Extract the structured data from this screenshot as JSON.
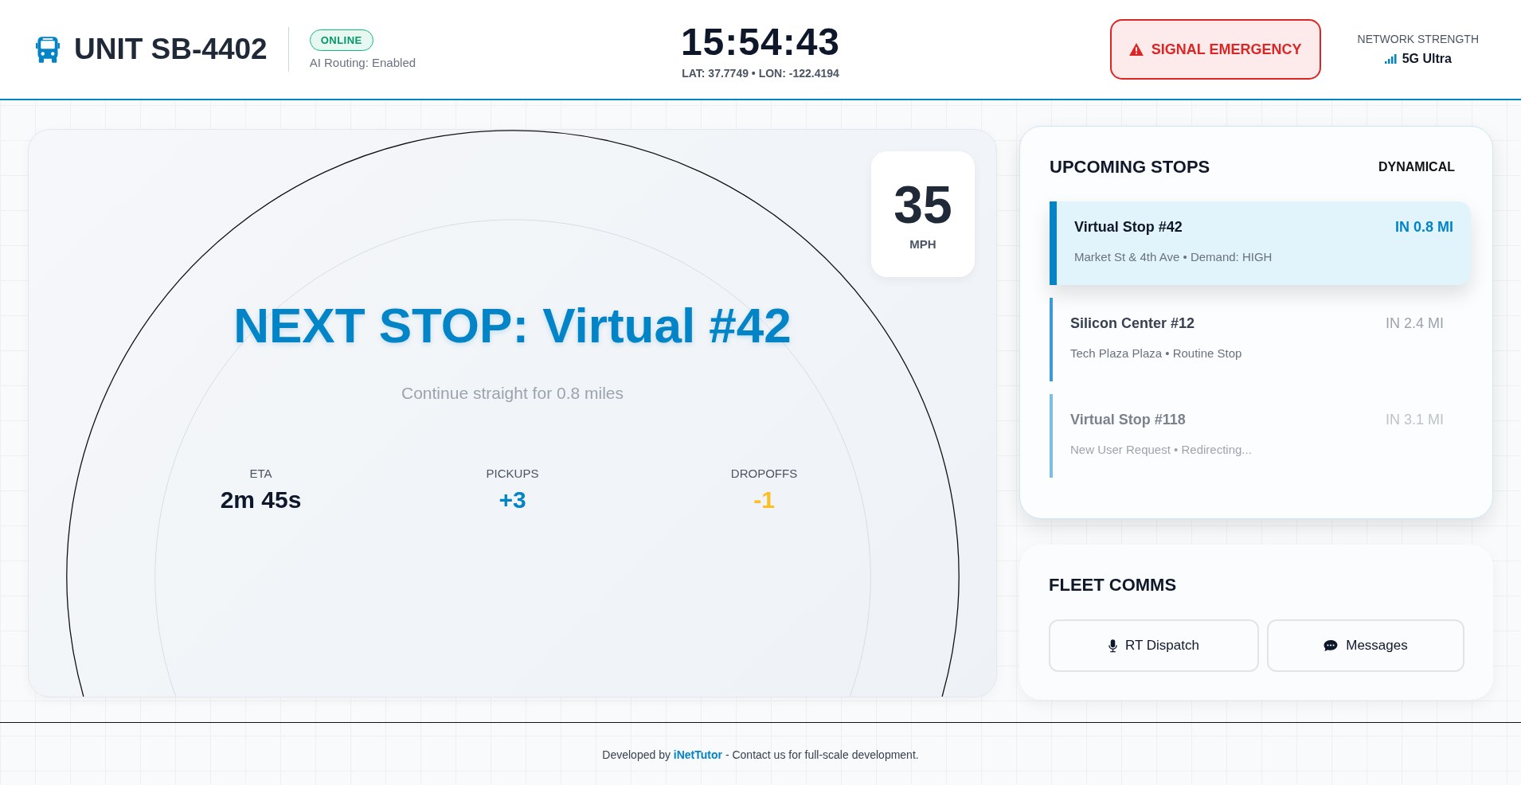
{
  "header": {
    "unit": "UNIT SB-4402",
    "status_badge": "ONLINE",
    "routing": "AI Routing: Enabled",
    "clock": "15:54:43",
    "coords": "LAT: 37.7749 • LON: -122.4194",
    "emergency_button": "SIGNAL EMERGENCY",
    "network": {
      "label": "NETWORK STRENGTH",
      "value": "5G Ultra"
    }
  },
  "navigation": {
    "speed": "35",
    "speed_unit": "MPH",
    "next_stop": "NEXT STOP: Virtual #42",
    "instruction": "Continue straight for 0.8 miles",
    "stats": [
      {
        "label": "ETA",
        "value": "2m 45s",
        "color": "#0f172a"
      },
      {
        "label": "PICKUPS",
        "value": "+3",
        "color": "#0284c7"
      },
      {
        "label": "DROPOFFS",
        "value": "-1",
        "color": "#fbbf24"
      }
    ]
  },
  "upcoming_stops": {
    "title": "UPCOMING STOPS",
    "mode": "DYNAMICAL",
    "stops": [
      {
        "name": "Virtual Stop #42",
        "detail": "Market St & 4th Ave • Demand: HIGH",
        "distance": "IN 0.8 MI",
        "selected": true,
        "dimmed": false
      },
      {
        "name": "Silicon Center #12",
        "detail": "Tech Plaza Plaza • Routine Stop",
        "distance": "IN 2.4 MI",
        "selected": false,
        "dimmed": false
      },
      {
        "name": "Virtual Stop #118",
        "detail": "New User Request • Redirecting...",
        "distance": "IN 3.1 MI",
        "selected": false,
        "dimmed": true
      }
    ]
  },
  "fleet_comms": {
    "title": "FLEET COMMS",
    "buttons": [
      {
        "label": "RT Dispatch",
        "kind": "voice"
      },
      {
        "label": "Messages",
        "kind": "chat"
      }
    ]
  },
  "footer": {
    "prefix": "Developed by",
    "link": "iNetTutor",
    "suffix": "- Contact us for full-scale development."
  }
}
